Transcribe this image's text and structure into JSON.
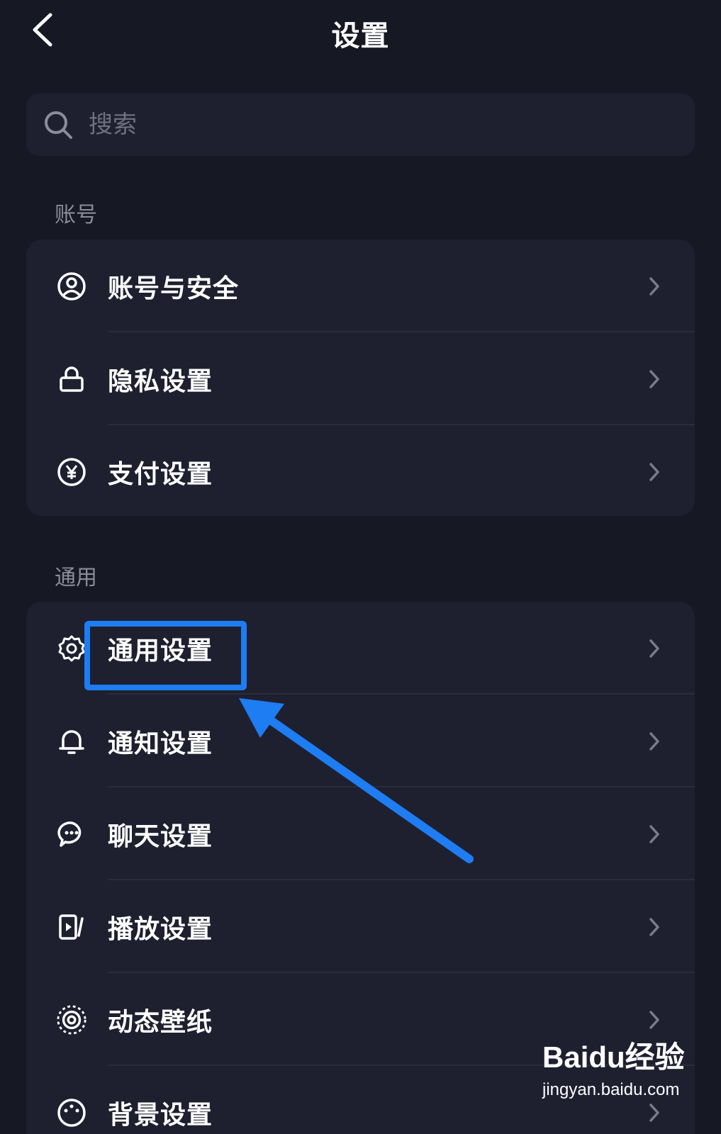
{
  "header": {
    "title": "设置"
  },
  "search": {
    "placeholder": "搜索"
  },
  "sections": [
    {
      "title": "账号",
      "items": [
        {
          "label": "账号与安全",
          "icon": "person-circle-icon"
        },
        {
          "label": "隐私设置",
          "icon": "lock-icon"
        },
        {
          "label": "支付设置",
          "icon": "yen-circle-icon"
        }
      ]
    },
    {
      "title": "通用",
      "items": [
        {
          "label": "通用设置",
          "icon": "gear-icon"
        },
        {
          "label": "通知设置",
          "icon": "bell-icon"
        },
        {
          "label": "聊天设置",
          "icon": "chat-bubble-icon"
        },
        {
          "label": "播放设置",
          "icon": "play-screen-icon"
        },
        {
          "label": "动态壁纸",
          "icon": "dynamic-wallpaper-icon"
        },
        {
          "label": "背景设置",
          "icon": "palette-icon"
        }
      ]
    }
  ],
  "annotation": {
    "highlight_color": "#1e7df3"
  },
  "watermark": {
    "brand": "Baidu经验",
    "url": "jingyan.baidu.com"
  },
  "colors": {
    "background": "#161824",
    "card": "#1e2030",
    "section_title": "#8a8c99",
    "chevron": "#7a7c8a"
  }
}
